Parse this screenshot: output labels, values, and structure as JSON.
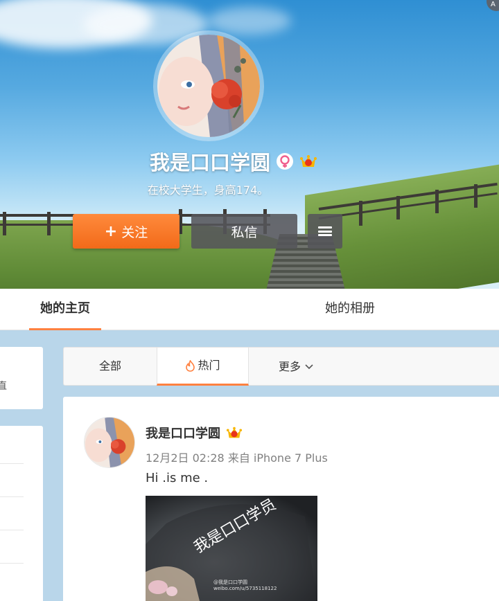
{
  "profile": {
    "name": "我是口口学圆",
    "bio": "在校大学生，身高174。",
    "follow_label": "关注",
    "follow_plus": "+",
    "message_label": "私信",
    "corner_badge": "A"
  },
  "tabs": {
    "home": "她的主页",
    "album": "她的相册"
  },
  "sidebar": {
    "cut_text": "直"
  },
  "filter": {
    "all": "全部",
    "hot": "热门",
    "more": "更多"
  },
  "post": {
    "author": "我是口口学圆",
    "meta": "12月2日 02:28 来自 iPhone 7 Plus",
    "text": "Hi .is me .",
    "image_caption": "我是口口学员",
    "watermark_line1": "@我是口口学圆",
    "watermark_line2": "weibo.com/u/5735118122"
  },
  "colors": {
    "accent": "#ff8140",
    "follow_button": "#f26a19",
    "dark_button": "#55555a",
    "meta_text": "#808080"
  },
  "icons": {
    "female": "female-icon",
    "vip": "vip-crown-icon",
    "menu": "hamburger-menu-icon",
    "hot": "flame-icon",
    "dropdown": "chevron-down-icon"
  }
}
